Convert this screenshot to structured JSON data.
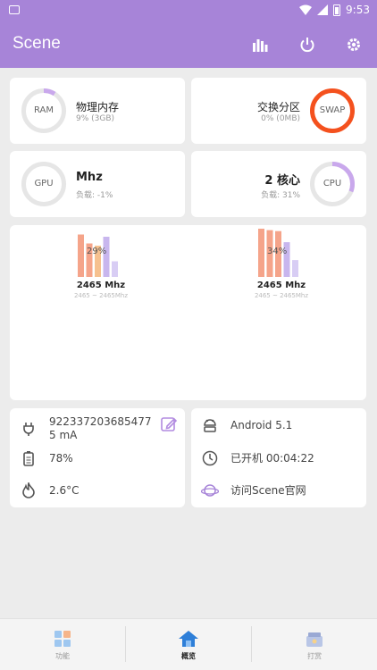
{
  "status_bar": {
    "time": "9:53"
  },
  "app": {
    "title": "Scene",
    "actions": [
      "chart-icon",
      "power-icon",
      "settings-icon"
    ]
  },
  "ram": {
    "ring_label": "RAM",
    "title": "物理内存",
    "detail": "9% (3GB)",
    "percent": 9
  },
  "swap": {
    "ring_label": "SWAP",
    "title": "交换分区",
    "detail": "0% (0MB)",
    "percent": 0
  },
  "gpu": {
    "ring_label": "GPU",
    "freq": "Mhz",
    "load": "负载: -1%",
    "percent": 0
  },
  "cpu": {
    "ring_label": "CPU",
    "cores": "2 核心",
    "load": "负载: 31%",
    "percent": 31
  },
  "clusters": [
    {
      "percent_label": "29%",
      "freq": "2465 Mhz",
      "range": "2465 ~ 2465Mhz",
      "bars": [
        0.95,
        0.75,
        0.7,
        0.9,
        0.35
      ],
      "bar_colors": [
        "#f5a48a",
        "#f5a48a",
        "#f6c18f",
        "#c8b6ee",
        "#d8cdf4"
      ]
    },
    {
      "percent_label": "34%",
      "freq": "2465 Mhz",
      "range": "2465 ~ 2465Mhz",
      "bars": [
        1.0,
        0.97,
        0.95,
        0.72,
        0.35
      ],
      "bar_colors": [
        "#f5a48a",
        "#f5a48a",
        "#f5a48a",
        "#c8b6ee",
        "#d8cdf4"
      ]
    }
  ],
  "battery_info": {
    "current": "9223372036854775 mA",
    "level": "78%",
    "temperature": "2.6°C"
  },
  "system_info": {
    "android": "Android 5.1",
    "uptime": "已开机  00:04:22",
    "visit": "访问Scene官网"
  },
  "nav": {
    "items": [
      {
        "label": "功能",
        "icon": "grid-icon"
      },
      {
        "label": "概览",
        "icon": "home-icon"
      },
      {
        "label": "打赏",
        "icon": "gift-icon"
      }
    ],
    "active": 1
  },
  "colors": {
    "accent": "#a784d8",
    "ring_bg": "#e6e6e6",
    "swap": "#f4511e",
    "ring_fill": "#c9a8ec"
  }
}
